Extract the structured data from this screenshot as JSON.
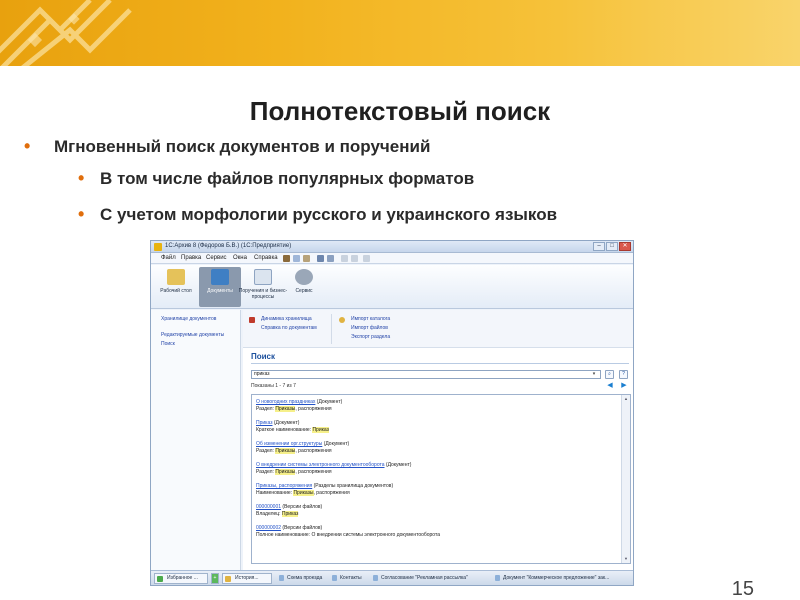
{
  "slide": {
    "title": "Полнотекстовый поиск",
    "bullet_main": "Мгновенный поиск документов и поручений",
    "sub_bullets": [
      "В том числе файлов популярных форматов",
      "С учетом морфологии русского и украинского языков"
    ],
    "page_number": "15",
    "colors": {
      "band": "#f2b21d",
      "bullet": "#e06e0c"
    }
  },
  "window": {
    "title": "1С:Архив 8 (Федоров Б.В.) (1С:Предприятие)",
    "menu": [
      "Файл",
      "Правка",
      "Сервис",
      "Окна",
      "Справка"
    ],
    "ribbon": [
      {
        "label": "Рабочий стол",
        "active": false,
        "icon": "desktop-icon"
      },
      {
        "label": "Документы",
        "active": true,
        "icon": "documents-icon"
      },
      {
        "label": "Поручения и бизнес-процессы",
        "active": false,
        "icon": "tasks-icon"
      },
      {
        "label": "Сервис",
        "active": false,
        "icon": "service-icon"
      }
    ],
    "left_nav": [
      "Хранилище документов",
      "Редактируемые документы",
      "Поиск"
    ],
    "actions_col1": [
      "Динамика хранилища",
      "Справка по документам"
    ],
    "actions_col2": [
      "Импорт каталога",
      "Импорт файлов",
      "Экспорт раздела"
    ],
    "search": {
      "title": "Поиск",
      "query": "приказ",
      "shown": "Показаны 1 - 7 из 7"
    },
    "results": [
      {
        "link": "О новогодних праздниках",
        "type": "(Документ)",
        "detail_prefix": "Раздел: ",
        "highlight": "Приказы",
        "detail_suffix": ", распоряжения"
      },
      {
        "link": "Приказ",
        "type": "(Документ)",
        "detail_prefix": "Краткое наименование: ",
        "highlight": "Приказ",
        "detail_suffix": ""
      },
      {
        "link": "Об изменении орг.структуры",
        "type": "(Документ)",
        "detail_prefix": "Раздел: ",
        "highlight": "Приказы",
        "detail_suffix": ", распоряжения"
      },
      {
        "link": "О внедрении системы электронного документооборота",
        "type": "(Документ)",
        "detail_prefix": "Раздел: ",
        "highlight": "Приказы",
        "detail_suffix": ", распоряжения"
      },
      {
        "link": "Приказы, распоряжения",
        "type": "(Разделы хранилища документов)",
        "detail_prefix": "Наименование: ",
        "highlight": "Приказы",
        "detail_suffix": ", распоряжения"
      },
      {
        "link": "000000001",
        "type": "(Версии файлов)",
        "detail_prefix": "Владелец: ",
        "highlight": "Приказ",
        "detail_suffix": ""
      },
      {
        "link": "000000002",
        "type": "(Версии файлов)",
        "detail_prefix": "Полное наименование: О внедрении системы электронного документооборота",
        "highlight": "",
        "detail_suffix": ""
      }
    ],
    "taskbar": {
      "favorites": "Избранное ...",
      "history": "История...",
      "items": [
        "Схема проезда",
        "Контакты",
        "Согласование \"Рекламная рассылка\"",
        "Документ \"Коммерческое предложение\" зак..."
      ]
    }
  }
}
